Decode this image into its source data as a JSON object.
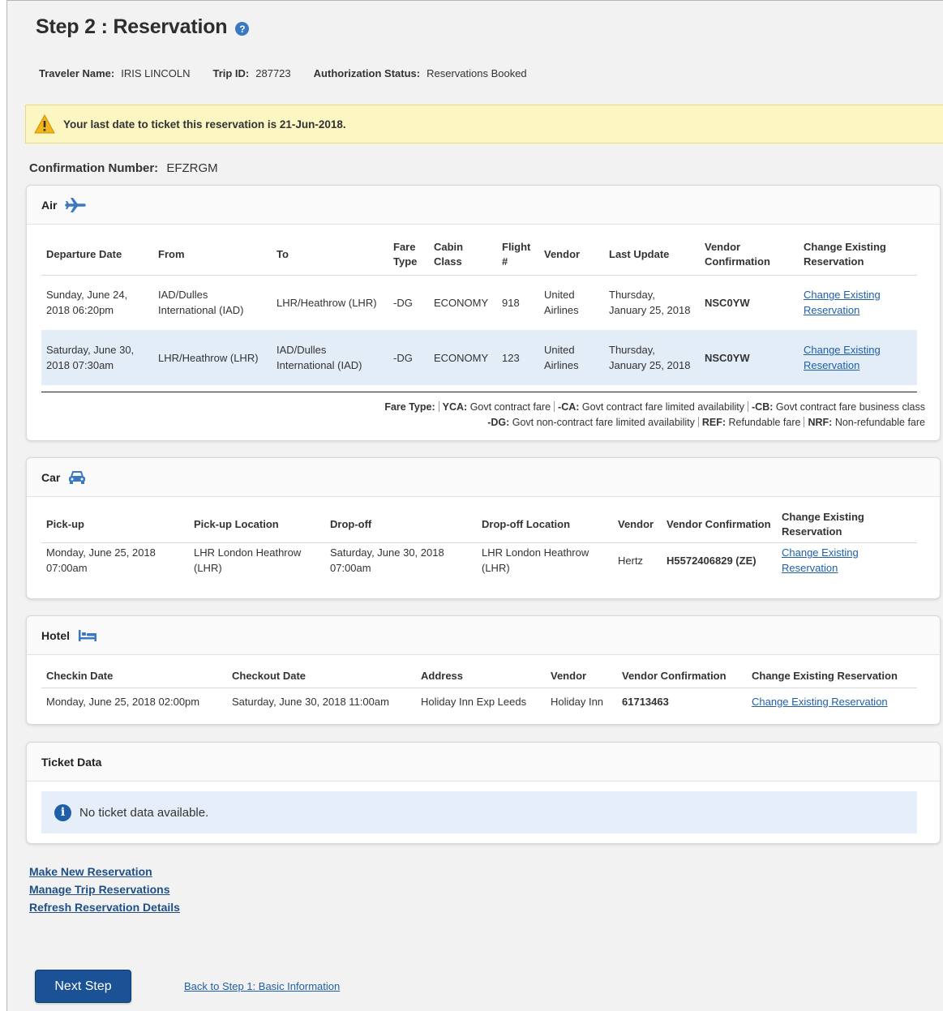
{
  "page": {
    "title": "Step 2 : Reservation",
    "help_icon": "question-circle-icon"
  },
  "meta": {
    "traveler_label": "Traveler Name:",
    "traveler_value": "IRIS LINCOLN",
    "trip_label": "Trip ID:",
    "trip_value": "287723",
    "auth_label": "Authorization Status:",
    "auth_value": "Reservations Booked"
  },
  "warning": {
    "icon": "warning-triangle-icon",
    "text": "Your last date to ticket this reservation is 21-Jun-2018.",
    "color": "#fbf6c2"
  },
  "confirmation": {
    "label": "Confirmation Number:",
    "value": "EFZRGM"
  },
  "air": {
    "title": "Air",
    "icon": "airplane-icon",
    "headers": [
      "Departure Date",
      "From",
      "To",
      "Fare Type",
      "Cabin Class",
      "Flight #",
      "Vendor",
      "Last Update",
      "Vendor Confirmation",
      "Change Existing Reservation"
    ],
    "rows": [
      {
        "departure": "Sunday, June 24, 2018 06:20pm",
        "from": "IAD/Dulles International (IAD)",
        "to": "LHR/Heathrow (LHR)",
        "fare_type": "-DG",
        "cabin": "ECONOMY",
        "flight": "918",
        "vendor": "United Airlines",
        "last_update": "Thursday, January 25, 2018",
        "vendor_conf": "NSC0YW",
        "change": "Change Existing Reservation"
      },
      {
        "departure": "Saturday, June 30, 2018 07:30am",
        "from": "LHR/Heathrow (LHR)",
        "to": "IAD/Dulles International (IAD)",
        "fare_type": "-DG",
        "cabin": "ECONOMY",
        "flight": "123",
        "vendor": "United Airlines",
        "last_update": "Thursday, January 25, 2018",
        "vendor_conf": "NSC0YW",
        "change": "Change Existing Reservation"
      }
    ],
    "fare_legend": {
      "label": "Fare Type:",
      "items": [
        {
          "code": "YCA:",
          "desc": "Govt contract fare"
        },
        {
          "code": "-CA:",
          "desc": "Govt contract fare limited availability"
        },
        {
          "code": "-CB:",
          "desc": "Govt contract fare business class"
        },
        {
          "code": "-DG:",
          "desc": "Govt non-contract fare limited availability"
        },
        {
          "code": "REF:",
          "desc": "Refundable fare"
        },
        {
          "code": "NRF:",
          "desc": "Non-refundable fare"
        }
      ]
    }
  },
  "car": {
    "title": "Car",
    "icon": "car-icon",
    "headers": [
      "Pick-up",
      "Pick-up Location",
      "Drop-off",
      "Drop-off Location",
      "Vendor",
      "Vendor Confirmation",
      "Change Existing Reservation"
    ],
    "rows": [
      {
        "pickup": "Monday, June 25, 2018 07:00am",
        "pickup_loc": "LHR London Heathrow (LHR)",
        "dropoff": "Saturday, June 30, 2018 07:00am",
        "dropoff_loc": "LHR London Heathrow (LHR)",
        "vendor": "Hertz",
        "vendor_conf": "H5572406829 (ZE)",
        "change": "Change Existing Reservation"
      }
    ]
  },
  "hotel": {
    "title": "Hotel",
    "icon": "bed-icon",
    "headers": [
      "Checkin Date",
      "Checkout Date",
      "Address",
      "Vendor",
      "Vendor Confirmation",
      "Change Existing Reservation"
    ],
    "rows": [
      {
        "checkin": "Monday, June 25, 2018 02:00pm",
        "checkout": "Saturday, June 30, 2018 11:00am",
        "address": "Holiday Inn Exp Leeds",
        "vendor": "Holiday Inn",
        "vendor_conf": "61713463",
        "change": "Change Existing Reservation"
      }
    ]
  },
  "ticket": {
    "title": "Ticket Data",
    "info_icon": "info-circle-icon",
    "message": "No ticket data available."
  },
  "links": {
    "make_new": "Make New Reservation",
    "manage": "Manage Trip Reservations",
    "refresh": "Refresh Reservation Details"
  },
  "footer": {
    "next": "Next Step",
    "back": "Back to Step 1: Basic Information"
  },
  "colors": {
    "accent": "#1b5296",
    "link": "#1f5fa8",
    "row_highlight": "#e3edf8",
    "info_bg": "#e6eff9"
  }
}
